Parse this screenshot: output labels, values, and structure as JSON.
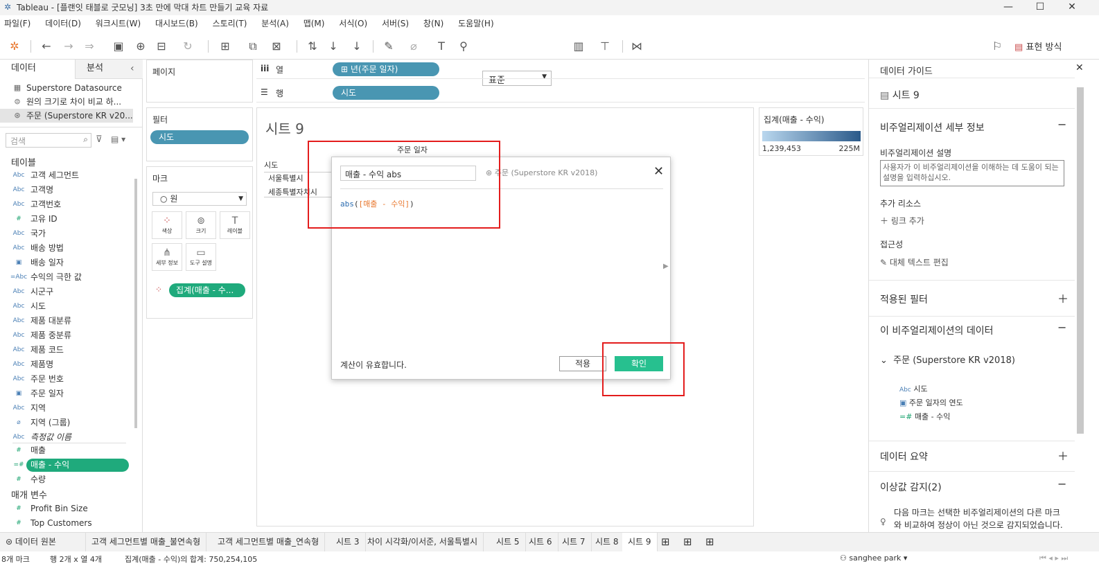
{
  "window": {
    "title": "Tableau - [플랜잇 태블로 굿모닝] 3초 만에 막대 차트 만들기 교육 자료",
    "minimize": "—",
    "maximize": "☐",
    "close": "✕"
  },
  "menu": [
    "파일(F)",
    "데이터(D)",
    "워크시트(W)",
    "대시보드(B)",
    "스토리(T)",
    "분석(A)",
    "맵(M)",
    "서식(O)",
    "서버(S)",
    "창(N)",
    "도움말(H)"
  ],
  "toolbar": {
    "fit_select": "표준",
    "show_me": "표현 방식"
  },
  "left": {
    "tab_data": "데이터",
    "tab_analysis": "분석",
    "datasources": [
      "Superstore Datasource",
      "원의 크기로 차이 비교 하...",
      "주문 (Superstore KR v20..."
    ],
    "search_placeholder": "검색",
    "tables_title": "테이블",
    "fields": [
      {
        "icon": "Abc",
        "name": "고객 세그먼트"
      },
      {
        "icon": "Abc",
        "name": "고객명"
      },
      {
        "icon": "Abc",
        "name": "고객번호"
      },
      {
        "icon": "#",
        "name": "고유 ID"
      },
      {
        "icon": "Abc",
        "name": "국가"
      },
      {
        "icon": "Abc",
        "name": "배송 방법"
      },
      {
        "icon": "▣",
        "name": "배송 일자"
      },
      {
        "icon": "=Abc",
        "name": "수익의 극한 값"
      },
      {
        "icon": "Abc",
        "name": "시군구"
      },
      {
        "icon": "Abc",
        "name": "시도"
      },
      {
        "icon": "Abc",
        "name": "제품 대분류"
      },
      {
        "icon": "Abc",
        "name": "제품 중분류"
      },
      {
        "icon": "Abc",
        "name": "제품 코드"
      },
      {
        "icon": "Abc",
        "name": "제품명"
      },
      {
        "icon": "Abc",
        "name": "주문 번호"
      },
      {
        "icon": "▣",
        "name": "주문 일자"
      },
      {
        "icon": "Abc",
        "name": "지역"
      },
      {
        "icon": "⌀",
        "name": "지역 (그룹)"
      },
      {
        "icon": "Abc",
        "name": "측정값 이름"
      }
    ],
    "measures": [
      {
        "icon": "#",
        "name": "매출"
      },
      {
        "icon": "=#",
        "name": "매출 - 수익"
      },
      {
        "icon": "#",
        "name": "수량"
      }
    ],
    "params_title": "매개 변수",
    "params": [
      {
        "icon": "#",
        "name": "Profit Bin Size"
      },
      {
        "icon": "#",
        "name": "Top Customers"
      }
    ]
  },
  "shelves": {
    "pages": "페이지",
    "filters": "필터",
    "filter_pill": "시도",
    "marks": "마크",
    "mark_type": "원",
    "mark_buttons": [
      "색상",
      "크기",
      "레이블",
      "세부 정보",
      "도구 설명"
    ],
    "mark_pill": "집계(매출 - 수...",
    "columns_label": "열",
    "columns_pill": "년(주문 일자)",
    "rows_label": "행",
    "rows_pill": "시도"
  },
  "sheet": {
    "title": "시트 9",
    "col_header": "주문 일자",
    "row_header": "시도",
    "rows": [
      "서울특별시",
      "세종특별자치시"
    ]
  },
  "legend": {
    "title": "집계(매출 - 수익)",
    "min": "1,239,453",
    "max": "225M"
  },
  "dialog": {
    "name": "매출 - 수익 abs",
    "source": "주문 (Superstore KR v2018)",
    "formula_fn": "abs",
    "formula_field": "[매출 - 수익]",
    "status": "계산이 유효합니다.",
    "apply": "적용",
    "ok": "확인"
  },
  "guide": {
    "title": "데이터 가이드",
    "sheet": "시트 9",
    "viz_details": "비주얼리제이션 세부 정보",
    "desc_label": "비주얼리제이션 설명",
    "desc_placeholder": "사용자가 이 비주얼리제이션을 이해하는 데 도움이 되는 설명을 입력하십시오.",
    "resources": "추가 리소스",
    "add_link": "링크 추가",
    "accessibility": "접근성",
    "alt_text": "대체 텍스트 편집",
    "applied_filters": "적용된 필터",
    "viz_data": "이 비주얼리제이션의 데이터",
    "source": "주문 (Superstore KR v2018)",
    "fields": [
      {
        "icon": "Abc",
        "name": "시도"
      },
      {
        "icon": "▣",
        "name": "주문 일자의 연도"
      },
      {
        "icon": "=#",
        "name": "매출 - 수익"
      }
    ],
    "data_summary": "데이터 요약",
    "outliers": "이상값 감지(2)",
    "outlier_text": "다음 마크는 선택한 비주얼리제이션의 다른 마크와 비교하여 정상이 아닌 것으로 감지되었습니다."
  },
  "tabs": [
    "데이터 원본",
    "고객 세그먼트별 매출_불연속형",
    "고객 세그먼트별 매출_연속형",
    "시트 3",
    "차이 시각화/이서준, 서울특별시",
    "시트 5",
    "시트 6",
    "시트 7",
    "시트 8",
    "시트 9"
  ],
  "status": {
    "marks": "8개 마크",
    "rows": "행 2개 x 열 4개",
    "sum": "집계(매출 - 수익)의 합계: 750,254,105",
    "user": "sanghee park"
  }
}
